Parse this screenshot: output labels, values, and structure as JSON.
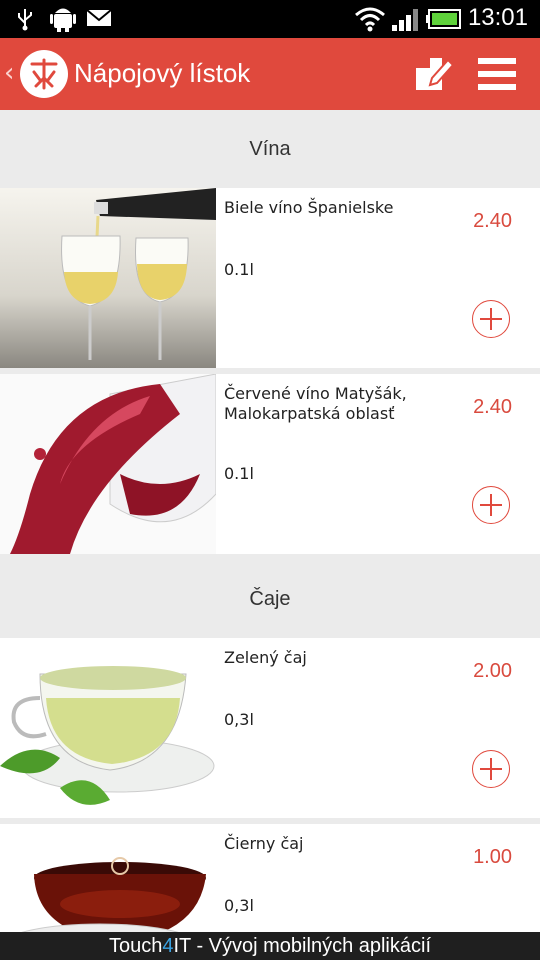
{
  "status": {
    "time": "13:01"
  },
  "header": {
    "title": "Nápojový lístok"
  },
  "sections": [
    {
      "title": "Vína"
    },
    {
      "title": "Čaje"
    }
  ],
  "items": [
    {
      "name": "Biele víno Španielske",
      "volume": "0.1l",
      "price": "2.40"
    },
    {
      "name": "Červené víno Matyšák, Malokarpatská oblasť",
      "volume": "0.1l",
      "price": "2.40"
    },
    {
      "name": "Zelený čaj",
      "volume": "0,3l",
      "price": "2.00"
    },
    {
      "name": "Čierny čaj",
      "volume": "0,3l",
      "price": "1.00"
    }
  ],
  "footer": {
    "part1": "Touch",
    "part2": "4",
    "part3": "IT - Vývoj mobilných aplikácií"
  },
  "colors": {
    "accent": "#e0493d",
    "price": "#d94a3e",
    "footer_bg": "#1f1f1f"
  }
}
